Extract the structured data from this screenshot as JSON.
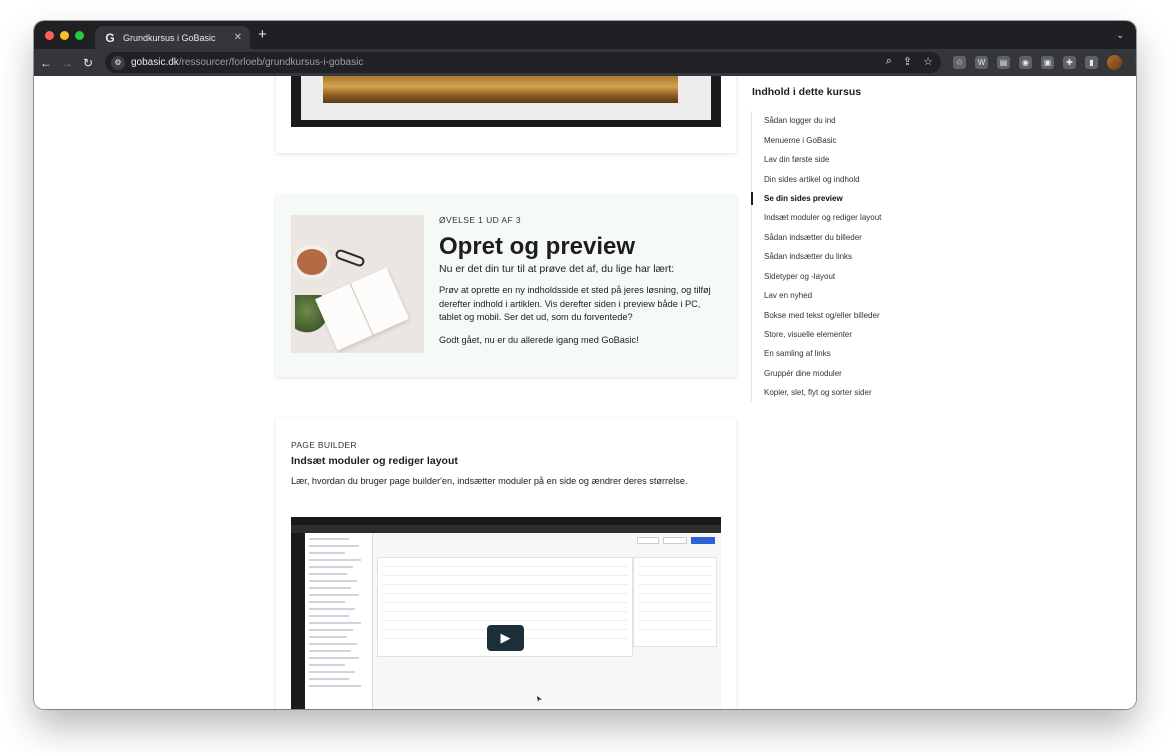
{
  "browser": {
    "tab_title": "Grundkursus i GoBasic",
    "tab_icon": "G",
    "url_host": "gobasic.dk",
    "url_path": "/ressourcer/forloeb/grundkursus-i-gobasic"
  },
  "exercise": {
    "eyebrow": "ØVELSE 1 UD AF 3",
    "title": "Opret og preview",
    "lead": "Nu er det din tur til at prøve det af, du lige har lært:",
    "body": "Prøv at oprette en ny indholdsside et sted på jeres løsning, og tilføj derefter indhold i artiklen. Vis derefter siden i preview både i PC, tablet og mobil. Ser det ud, som du forventede?",
    "closing": "Godt gået, nu er du allerede igang med GoBasic!"
  },
  "page_builder": {
    "label": "PAGE BUILDER",
    "title": "Indsæt moduler og rediger layout",
    "description": "Lær, hvordan du bruger page builder'en, indsætter moduler på en side og ændrer deres størrelse."
  },
  "sidebar": {
    "title": "Indhold i dette kursus",
    "active_index": 4,
    "items": [
      "Sådan logger du ind",
      "Menuerne i GoBasic",
      "Lav din første side",
      "Din sides artikel og indhold",
      "Se din sides preview",
      "Indsæt moduler og rediger layout",
      "Sådan indsætter du billeder",
      "Sådan indsætter du links",
      "Sidetyper og -layout",
      "Lav en nyhed",
      "Bokse med tekst og/eller billeder",
      "Store, visuelle elementer",
      "En samling af links",
      "Gruppér dine moduler",
      "Kopier, slet, flyt og sorter sider"
    ]
  },
  "colors": {
    "traffic_red": "#ff5f57",
    "traffic_yellow": "#febc2e",
    "traffic_green": "#28c840",
    "exercise_bg": "#f6faf7",
    "play_button": "#1b2f3a"
  }
}
